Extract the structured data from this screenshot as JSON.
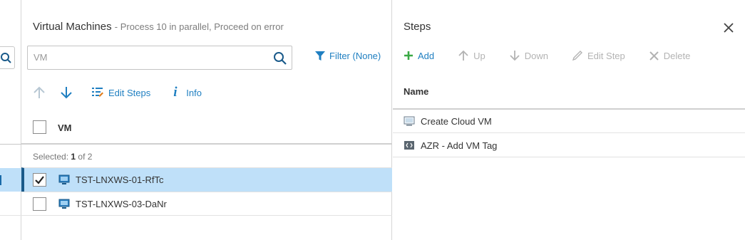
{
  "vm_panel": {
    "title": "Virtual Machines",
    "subtitle": "- Process 10 in parallel, Proceed on error",
    "search": {
      "placeholder": "VM",
      "value": ""
    },
    "filter_label": "Filter (None)",
    "toolbar": {
      "edit_steps": "Edit Steps",
      "info": "Info"
    },
    "column_header": "VM",
    "selected_prefix": "Selected: ",
    "selected_count": "1",
    "selected_suffix": " of 2",
    "rows": [
      {
        "name": "TST-LNXWS-01-RfTc",
        "checked": true
      },
      {
        "name": "TST-LNXWS-03-DaNr",
        "checked": false
      }
    ]
  },
  "steps_panel": {
    "title": "Steps",
    "toolbar": {
      "add": "Add",
      "up": "Up",
      "down": "Down",
      "edit_step": "Edit Step",
      "delete": "Delete"
    },
    "column_header": "Name",
    "steps": [
      {
        "name": "Create Cloud VM",
        "icon": "cloud-vm-icon"
      },
      {
        "name": "AZR - Add VM Tag",
        "icon": "script-icon"
      }
    ]
  },
  "colors": {
    "accent": "#1f7fc1",
    "selected_row": "#bfe0f9",
    "add_green": "#3aa945",
    "disabled": "#b3b3b3"
  }
}
